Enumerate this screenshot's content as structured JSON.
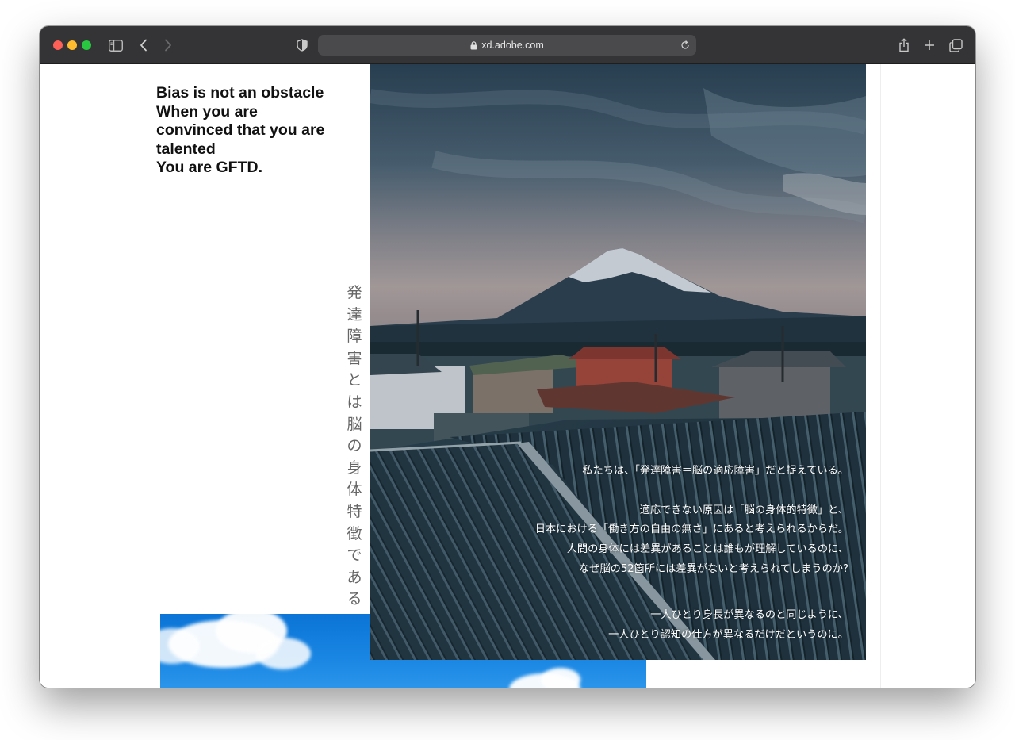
{
  "browser": {
    "url": "xd.adobe.com",
    "icons": {
      "sidebar": "sidebar-icon",
      "back": "chevron-left-icon",
      "forward": "chevron-right-icon",
      "privacy": "shield-icon",
      "lock": "lock-icon",
      "reload": "reload-icon",
      "share": "share-icon",
      "new_tab": "plus-icon",
      "tabs": "tab-overview-icon"
    }
  },
  "page": {
    "headline": [
      "Bias is not an obstacle",
      "When you are",
      "convinced that you are",
      "talented",
      "You are GFTD."
    ],
    "vertical_text": [
      "発",
      "達",
      "障",
      "害",
      "と",
      "は",
      "脳",
      "の",
      "身",
      "体",
      "特",
      "徴",
      "で",
      "あ",
      "る"
    ],
    "overlay": {
      "p1": "私たちは、「発達障害＝脳の適応障害」だと捉えている。",
      "p2": [
        "適応できない原因は「脳の身体的特徴」と、",
        "日本における「働き方の自由の無さ」にあると考えられるからだ。",
        "人間の身体には差異があることは誰もが理解しているのに、",
        "なぜ脳の52箇所には差異がないと考えられてしまうのか?"
      ],
      "p3": [
        "一人ひとり身長が異なるのと同じように、",
        "一人ひとり認知の仕方が異なるだけだというのに。"
      ]
    },
    "images": {
      "hero": "mount-fuji-rooftops-photo",
      "sky": "blue-sky-clouds-photo"
    }
  }
}
